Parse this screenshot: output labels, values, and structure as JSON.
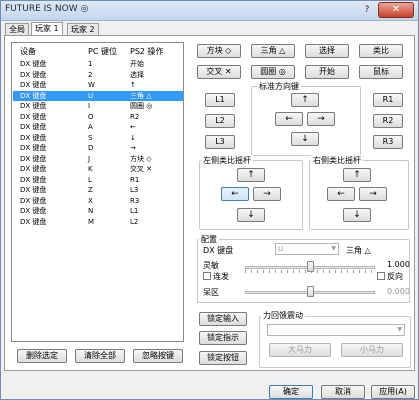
{
  "window": {
    "title": "FUTURE IS NOW ◎",
    "help": "?",
    "close": "✕"
  },
  "tabs": [
    {
      "label": "全局"
    },
    {
      "label": "玩家 1"
    },
    {
      "label": "玩家 2"
    }
  ],
  "list": {
    "headers": {
      "device": "设备",
      "key": "PC 键位",
      "action": "PS2 操作"
    },
    "rows": [
      {
        "device": "DX 键盘",
        "key": "1",
        "action": "开始"
      },
      {
        "device": "DX 键盘",
        "key": "2",
        "action": "选择"
      },
      {
        "device": "DX 键盘",
        "key": "W",
        "action": "↑"
      },
      {
        "device": "DX 键盘",
        "key": "U",
        "action": "三角 △"
      },
      {
        "device": "DX 键盘",
        "key": "I",
        "action": "圆圈 ◎"
      },
      {
        "device": "DX 键盘",
        "key": "O",
        "action": "R2"
      },
      {
        "device": "DX 键盘",
        "key": "A",
        "action": "←"
      },
      {
        "device": "DX 键盘",
        "key": "S",
        "action": "↓"
      },
      {
        "device": "DX 键盘",
        "key": "D",
        "action": "→"
      },
      {
        "device": "DX 键盘",
        "key": "J",
        "action": "方块 ◇"
      },
      {
        "device": "DX 键盘",
        "key": "K",
        "action": "交叉 ✕"
      },
      {
        "device": "DX 键盘",
        "key": "L",
        "action": "R1"
      },
      {
        "device": "DX 键盘",
        "key": "Z",
        "action": "L3"
      },
      {
        "device": "DX 键盘",
        "key": "X",
        "action": "R3"
      },
      {
        "device": "DX 键盘",
        "key": "N",
        "action": "L1"
      },
      {
        "device": "DX 键盘",
        "key": "M",
        "action": "L2"
      }
    ],
    "selected_index": 3
  },
  "list_buttons": {
    "delete": "删除选定",
    "clear": "清除全部",
    "ignore": "忽略按键"
  },
  "face_buttons": {
    "square": "方块 ◇",
    "triangle": "三角 △",
    "select": "选择",
    "analog": "类比",
    "cross": "交叉 ✕",
    "circle": "圆圈 ◎",
    "start": "开始",
    "mouse": "鼠标"
  },
  "shoulders": {
    "l1": "L1",
    "l2": "L2",
    "l3": "L3",
    "r1": "R1",
    "r2": "R2",
    "r3": "R3"
  },
  "dpad": {
    "label": "标准方向键",
    "up": "↑",
    "left": "←",
    "right": "→",
    "down": "↓"
  },
  "left_stick": {
    "label": "左侧类比摇杆",
    "up": "↑",
    "left": "←",
    "right": "→",
    "down": "↓"
  },
  "right_stick": {
    "label": "右侧类比摇杆",
    "up": "↑",
    "left": "←",
    "right": "→",
    "down": "↓"
  },
  "config": {
    "label": "配置",
    "device": "DX 键盘",
    "key_value": "U",
    "mapped": "三角 △",
    "sensitivity_label": "灵敏",
    "sensitivity_value": "1.000",
    "sensitivity_level": 0.5,
    "turbo_label": "连发",
    "reverse_label": "反向",
    "deadzone_label": "呆区",
    "deadzone_value": "0.000",
    "deadzone_level": 0.5
  },
  "lock_buttons": {
    "input": "锁定输入",
    "direction": "锁定指示",
    "button": "锁定按钮"
  },
  "force_feedback": {
    "label": "力回馈震动",
    "big": "大马力",
    "small": "小马力"
  },
  "footer": {
    "ok": "确定",
    "cancel": "取消",
    "apply": "应用(A)"
  }
}
